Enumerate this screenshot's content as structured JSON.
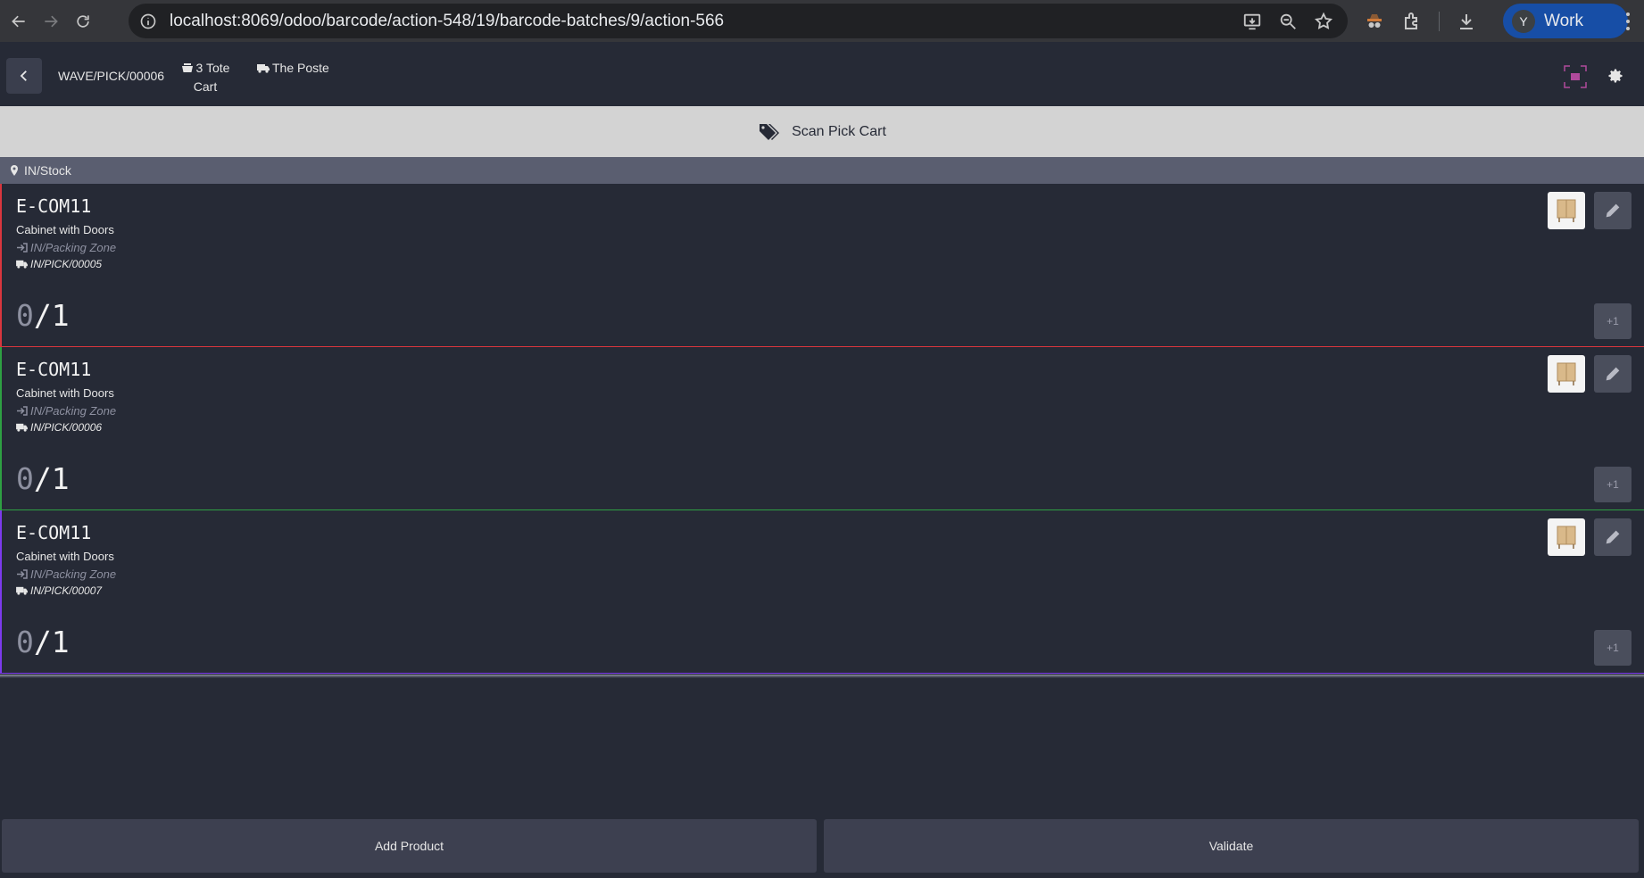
{
  "browser": {
    "url": "localhost:8069/odoo/barcode/action-548/19/barcode-batches/9/action-566",
    "profile_initial": "Y",
    "profile_label": "Work"
  },
  "header": {
    "wave_name": "WAVE/PICK/00006",
    "cart_line1": "3 Tote",
    "cart_line2": "Cart",
    "carrier": "The Poste"
  },
  "banner": {
    "text": "Scan Pick Cart"
  },
  "location": {
    "name": "IN/Stock"
  },
  "lines": [
    {
      "code": "E-COM11",
      "product": "Cabinet with Doors",
      "destination": "IN/Packing Zone",
      "picking": "IN/PICK/00005",
      "qty_done": "0",
      "qty_total": "/1",
      "accent": "#d9363e",
      "plus_label": "+1"
    },
    {
      "code": "E-COM11",
      "product": "Cabinet with Doors",
      "destination": "IN/Packing Zone",
      "picking": "IN/PICK/00006",
      "qty_done": "0",
      "qty_total": "/1",
      "accent": "#2ea043",
      "plus_label": "+1"
    },
    {
      "code": "E-COM11",
      "product": "Cabinet with Doors",
      "destination": "IN/Packing Zone",
      "picking": "IN/PICK/00007",
      "qty_done": "0",
      "qty_total": "/1",
      "accent": "#7c3aed",
      "plus_label": "+1"
    }
  ],
  "footer": {
    "add_product": "Add Product",
    "validate": "Validate"
  },
  "colors": {
    "background": "#262a36",
    "banner": "#d3d3d3",
    "location_bar": "#5a5e70",
    "button": "#3d4050"
  }
}
